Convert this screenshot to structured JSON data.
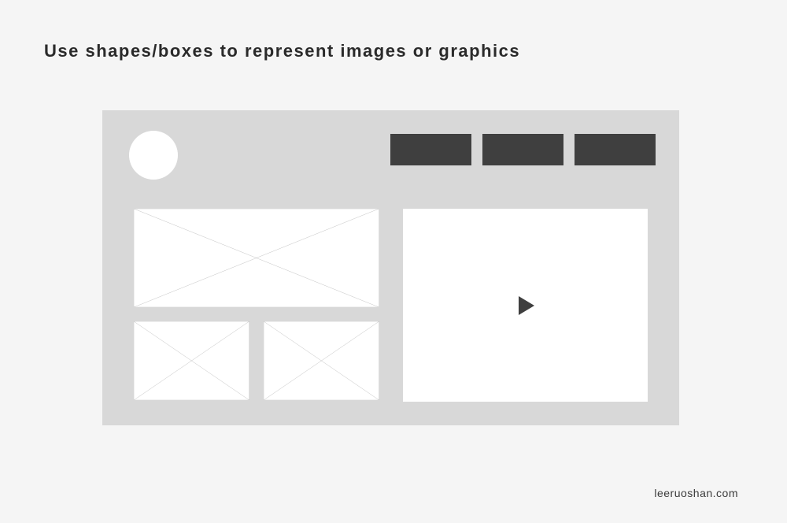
{
  "heading": "Use shapes/boxes to represent images or graphics",
  "attribution": "leeruoshan.com",
  "colors": {
    "page_bg": "#f5f5f5",
    "container_bg": "#d8d8d8",
    "placeholder_bg": "#ffffff",
    "nav_btn_bg": "#3f3f3f",
    "play_icon": "#3f3f3f",
    "text": "#2a2a2a"
  }
}
